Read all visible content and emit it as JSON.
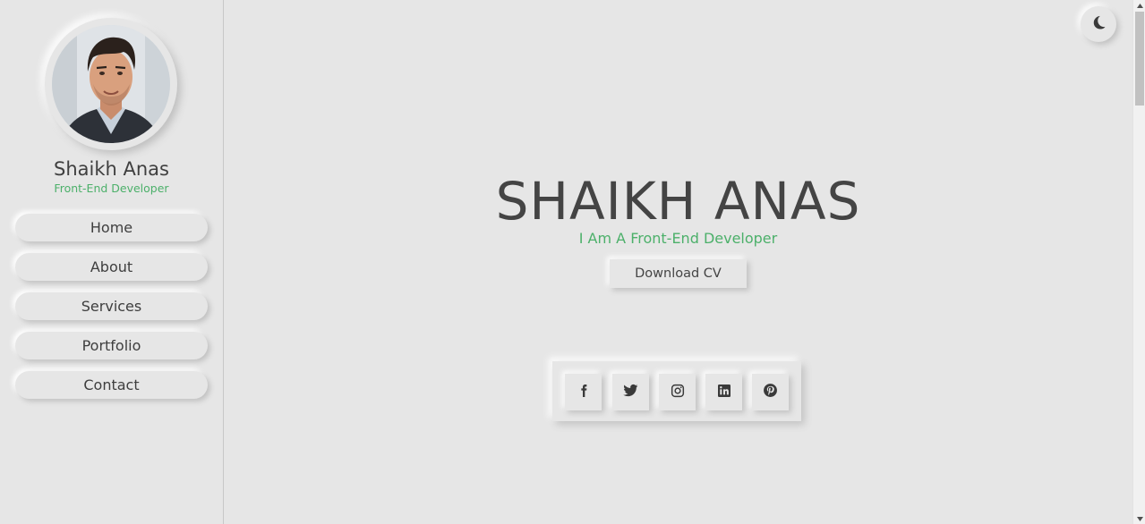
{
  "profile": {
    "name": "Shaikh Anas",
    "role": "Front-End Developer"
  },
  "nav": {
    "items": [
      {
        "label": "Home"
      },
      {
        "label": "About"
      },
      {
        "label": "Services"
      },
      {
        "label": "Portfolio"
      },
      {
        "label": "Contact"
      }
    ]
  },
  "hero": {
    "title": "SHAIKH ANAS",
    "subtitle": "I Am A Front-End Developer",
    "cv_button": "Download CV"
  },
  "theme_toggle": {
    "icon": "moon-icon"
  },
  "social": [
    {
      "icon": "facebook-icon"
    },
    {
      "icon": "twitter-icon"
    },
    {
      "icon": "instagram-icon"
    },
    {
      "icon": "linkedin-icon"
    },
    {
      "icon": "pinterest-icon"
    }
  ],
  "colors": {
    "background": "#e6e6e6",
    "accent": "#4cb06a",
    "text": "#444444"
  }
}
